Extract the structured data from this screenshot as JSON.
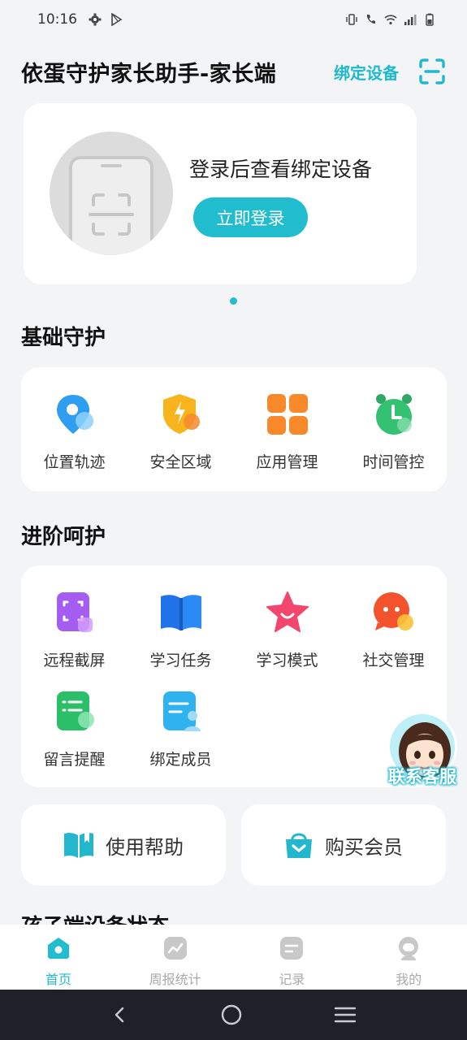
{
  "status_bar": {
    "time": "10:16",
    "left_icons": [
      "gear-icon",
      "play-store-icon"
    ],
    "right_icons": [
      "vibrate-icon",
      "call-icon",
      "wifi-icon",
      "signal-icon",
      "battery-icon"
    ]
  },
  "header": {
    "title": "依蛋守护家长助手-家长端",
    "bind_label": "绑定设备",
    "scan_icon": "scan-icon"
  },
  "login_card": {
    "text": "登录后查看绑定设备",
    "button_label": "立即登录"
  },
  "basic": {
    "title": "基础守护",
    "items": [
      {
        "label": "位置轨迹",
        "icon": "location-icon"
      },
      {
        "label": "安全区域",
        "icon": "shield-icon"
      },
      {
        "label": "应用管理",
        "icon": "apps-grid-icon"
      },
      {
        "label": "时间管控",
        "icon": "alarm-clock-icon"
      }
    ]
  },
  "advanced": {
    "title": "进阶呵护",
    "items": [
      {
        "label": "远程截屏",
        "icon": "screenshot-icon"
      },
      {
        "label": "学习任务",
        "icon": "book-icon"
      },
      {
        "label": "学习模式",
        "icon": "star-icon"
      },
      {
        "label": "社交管理",
        "icon": "chat-icon"
      },
      {
        "label": "留言提醒",
        "icon": "message-note-icon"
      },
      {
        "label": "绑定成员",
        "icon": "member-icon"
      }
    ]
  },
  "help": {
    "label": "使用帮助",
    "icon": "help-book-icon"
  },
  "vip": {
    "label": "购买会员",
    "icon": "vip-bag-icon"
  },
  "partial_section_title": "孩子端设备状态",
  "service": {
    "label": "联系客服"
  },
  "tabs": [
    {
      "label": "首页",
      "icon": "home-icon",
      "active": true
    },
    {
      "label": "周报统计",
      "icon": "chart-icon",
      "active": false
    },
    {
      "label": "记录",
      "icon": "record-icon",
      "active": false
    },
    {
      "label": "我的",
      "icon": "profile-icon",
      "active": false
    }
  ],
  "colors": {
    "accent": "#22bccf",
    "background": "#f3f4f6",
    "nav_bar": "#1e2228"
  }
}
